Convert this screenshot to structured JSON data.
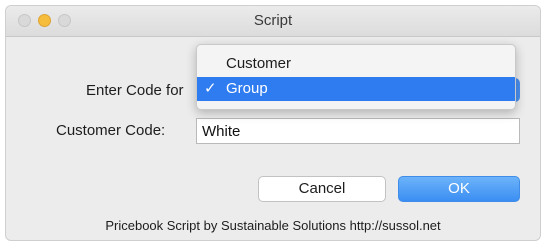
{
  "window": {
    "title": "Script"
  },
  "form": {
    "code_for_label": "Enter Code for",
    "customer_code_label": "Customer Code:",
    "customer_code_value": "White",
    "popup_arrows": "▲▼"
  },
  "menu": {
    "items": [
      {
        "label": "Customer",
        "checked": false,
        "check_mark": ""
      },
      {
        "label": "Group",
        "checked": true,
        "check_mark": "✓"
      }
    ]
  },
  "buttons": {
    "cancel_label": "Cancel",
    "ok_label": "OK"
  },
  "footer": {
    "text": "Pricebook Script by Sustainable Solutions http://sussol.net"
  },
  "colors": {
    "accent": "#2f7bf0",
    "ok_button": "#4a95f4",
    "traffic_minimize": "#f5bd3b",
    "window_bg": "#ececec"
  }
}
